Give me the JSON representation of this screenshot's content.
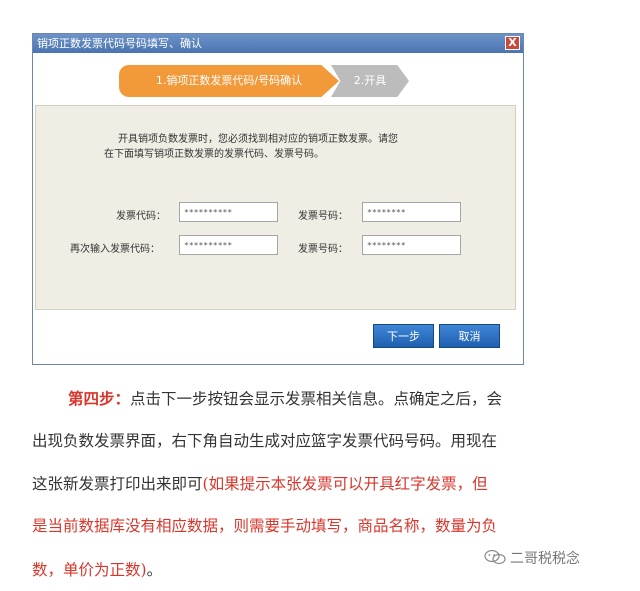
{
  "dialog": {
    "title": "销项正数发票代码号码填写、确认",
    "close_glyph": "X",
    "steps": [
      "1.销项正数发票代码/号码确认",
      "2.开具"
    ],
    "instruction_line1": "开具销项负数发票时，您必须找到相对应的销项正数发票。请您",
    "instruction_line2": "在下面填写销项正数发票的发票代码、发票号码。",
    "fields": [
      {
        "label": "发票代码：",
        "value": "**********"
      },
      {
        "label": "发票号码：",
        "value": "********"
      },
      {
        "label": "再次输入发票代码：",
        "value": "**********"
      },
      {
        "label": "发票号码：",
        "value": "********"
      }
    ],
    "next_label": "下一步",
    "cancel_label": "取消"
  },
  "article": {
    "step_label": "第四步：",
    "line1_rest": "点击下一步按钮会显示发票相关信息。点确定之后，会",
    "line2": "出现负数发票界面，右下角自动生成对应篮字发票代码号码。用现在",
    "line3_black": "这张新发票打印出来即可",
    "line3_red": "(如果提示本张发票可以开具红字发票，但",
    "line4_red": "是当前数据库没有相应数据，则需要手动填写，商品名称，数量为负",
    "line5_red": "数，单价为正数)",
    "line5_end": "。"
  },
  "watermark": {
    "text": "二哥税税念",
    "icon": "wechat-icon"
  },
  "colors": {
    "accent_red": "#d9362b",
    "step_orange": "#f29a3a",
    "button_blue": "#2a6fc2",
    "titlebar_blue": "#5a82bd"
  }
}
